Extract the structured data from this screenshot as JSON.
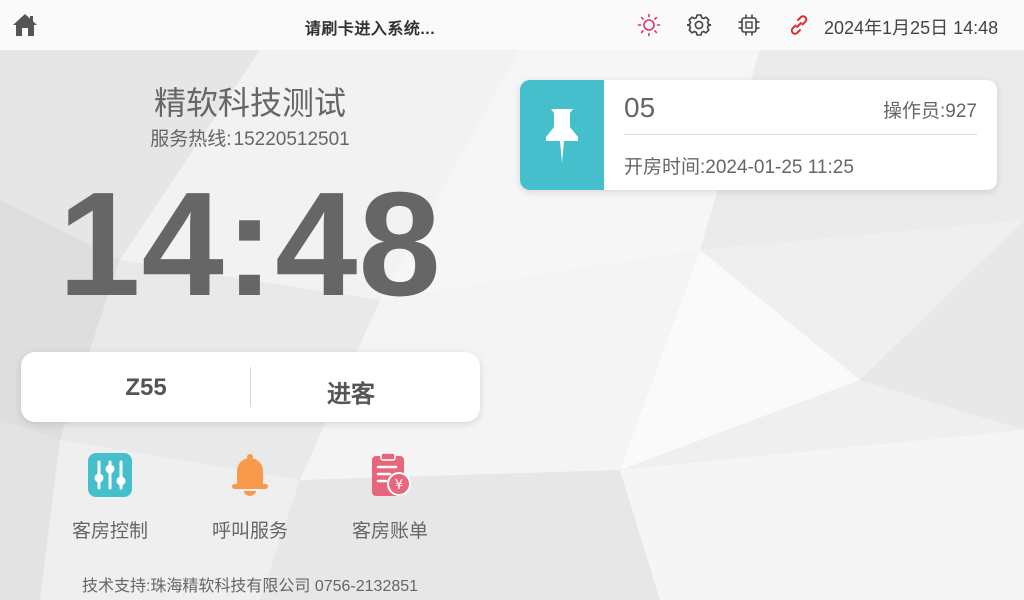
{
  "topbar": {
    "title": "请刷卡进入系统...",
    "datetime": "2024年1月25日 14:48",
    "icons": [
      "home-icon",
      "sun-icon",
      "gear-icon",
      "chip-icon",
      "link-icon"
    ]
  },
  "hotel": {
    "name": "精软科技测试",
    "hotline_label": "服务热线:",
    "hotline_number": "15220512501"
  },
  "clock": {
    "time": "14:48"
  },
  "status": {
    "room": "Z55",
    "state": "进客"
  },
  "functions": [
    {
      "label": "客房控制",
      "icon": "sliders-icon",
      "color": "#44bfcb"
    },
    {
      "label": "呼叫服务",
      "icon": "bell-icon",
      "color": "#f79a4c"
    },
    {
      "label": "客房账单",
      "icon": "bill-icon",
      "color": "#e8667c"
    }
  ],
  "footer": {
    "text": "技术支持:珠海精软科技有限公司 0756-2132851"
  },
  "info_card": {
    "room_code": "05",
    "operator_label": "操作员:",
    "operator_value": "927",
    "checkin_label": "开房时间:",
    "checkin_time": "2024-01-25 11:25",
    "accent": "#44bfcb",
    "icon": "pushpin-icon"
  },
  "colors": {
    "accent_teal": "#44bfcb",
    "sun_pink": "#e0336b",
    "link_red": "#e02b2b"
  }
}
